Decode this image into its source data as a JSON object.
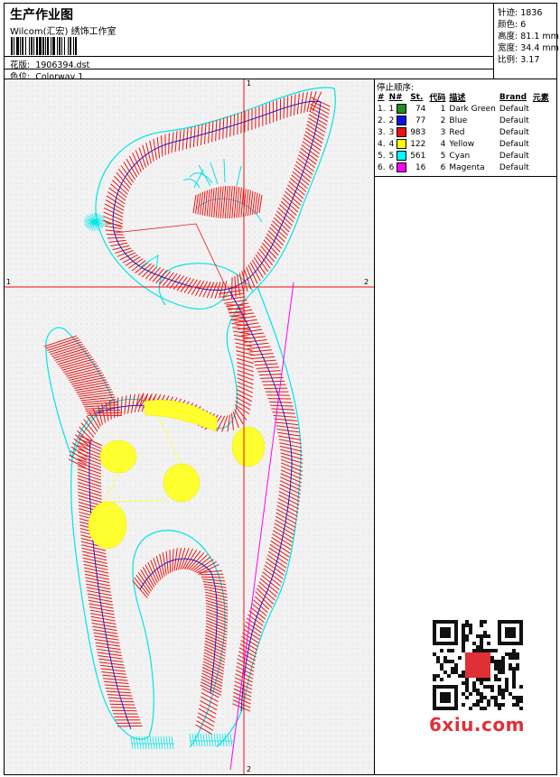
{
  "header": {
    "title": "生产作业图",
    "company": "Wilcom(汇宏) 绣饰工作室",
    "design_label": "花版:",
    "design_value": "1906394.dst",
    "colorway_label": "色位:",
    "colorway_value": "Colorway 1"
  },
  "stats": [
    {
      "label": "针迹:",
      "value": "1836"
    },
    {
      "label": "颜色:",
      "value": "6"
    },
    {
      "label": "高度:",
      "value": "81.1 mm"
    },
    {
      "label": "宽度:",
      "value": "34.4 mm"
    },
    {
      "label": "比例:",
      "value": "3.17"
    }
  ],
  "stop_sequence": {
    "heading": "停止顺序:",
    "columns": [
      "#",
      "N#",
      "St.",
      "代码",
      "描述",
      "Brand",
      "元素"
    ],
    "rows": [
      {
        "idx": "1.",
        "n": "1",
        "color": "#1f8f1f",
        "st": "74",
        "code": "1",
        "desc": "Dark Green",
        "brand": "Default"
      },
      {
        "idx": "2.",
        "n": "2",
        "color": "#1010e0",
        "st": "77",
        "code": "2",
        "desc": "Blue",
        "brand": "Default"
      },
      {
        "idx": "3.",
        "n": "3",
        "color": "#ee1010",
        "st": "983",
        "code": "3",
        "desc": "Red",
        "brand": "Default"
      },
      {
        "idx": "4.",
        "n": "4",
        "color": "#ffff00",
        "st": "122",
        "code": "4",
        "desc": "Yellow",
        "brand": "Default"
      },
      {
        "idx": "5.",
        "n": "5",
        "color": "#00ffff",
        "st": "561",
        "code": "5",
        "desc": "Cyan",
        "brand": "Default"
      },
      {
        "idx": "6.",
        "n": "6",
        "color": "#ff00ff",
        "st": "16",
        "code": "6",
        "desc": "Magenta",
        "brand": "Default"
      }
    ]
  },
  "axis_labels": {
    "top": "1",
    "bottom": "2",
    "left": "1",
    "right": "2"
  },
  "watermark": {
    "text": "6xiu.com"
  },
  "colors": {
    "red": "#ee1010",
    "cyan": "#00e5e5",
    "blue": "#2020c0",
    "yellow": "#ffff30",
    "magenta": "#ff00ff",
    "green": "#1f8f1f"
  }
}
